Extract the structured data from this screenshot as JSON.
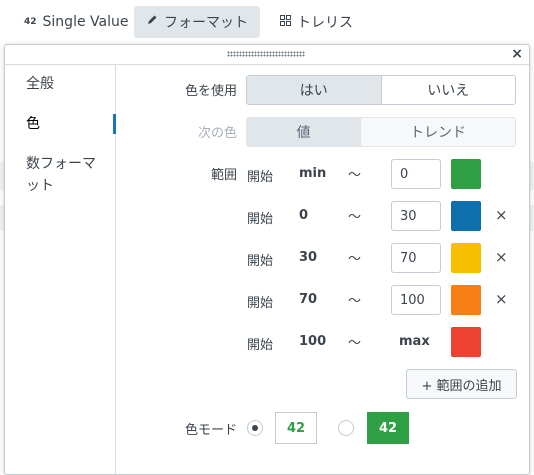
{
  "tabs": [
    {
      "label": "Single Value",
      "icon": "42-icon"
    },
    {
      "label": "フォーマット",
      "icon": "pencil-icon"
    },
    {
      "label": "トレリス",
      "icon": "grid-icon"
    }
  ],
  "tab_icon_text": "42",
  "sidebar": {
    "items": [
      {
        "label": "全般"
      },
      {
        "label": "色"
      },
      {
        "label": "数フォーマット"
      }
    ],
    "active_index": 1
  },
  "color_use": {
    "label": "色を使用",
    "options": [
      "はい",
      "いいえ"
    ],
    "selected": "はい"
  },
  "color_by": {
    "label": "次の色",
    "options": [
      "値",
      "トレンド"
    ],
    "selected": "値"
  },
  "ranges": {
    "label": "範囲",
    "rows": [
      {
        "start_label": "開始",
        "from": "min",
        "tilde": "〜",
        "to": "0",
        "to_is_input": true,
        "color": "#2ea043",
        "removable": false
      },
      {
        "start_label": "開始",
        "from": "0",
        "tilde": "〜",
        "to": "30",
        "to_is_input": true,
        "color": "#0e6fad",
        "removable": true
      },
      {
        "start_label": "開始",
        "from": "30",
        "tilde": "〜",
        "to": "70",
        "to_is_input": true,
        "color": "#f8be00",
        "removable": true
      },
      {
        "start_label": "開始",
        "from": "70",
        "tilde": "〜",
        "to": "100",
        "to_is_input": true,
        "color": "#f87e16",
        "removable": true
      },
      {
        "start_label": "開始",
        "from": "100",
        "tilde": "〜",
        "to": "max",
        "to_is_input": false,
        "color": "#ee4230",
        "removable": false
      }
    ],
    "remove_symbol": "×",
    "add_button": "+ 範囲の追加"
  },
  "color_mode": {
    "label": "色モード",
    "options": [
      {
        "value": "42",
        "style": "text",
        "checked": true,
        "color": "#2ea043"
      },
      {
        "value": "42",
        "style": "fill",
        "checked": false,
        "color": "#2ea043"
      }
    ]
  },
  "close_symbol": "×"
}
